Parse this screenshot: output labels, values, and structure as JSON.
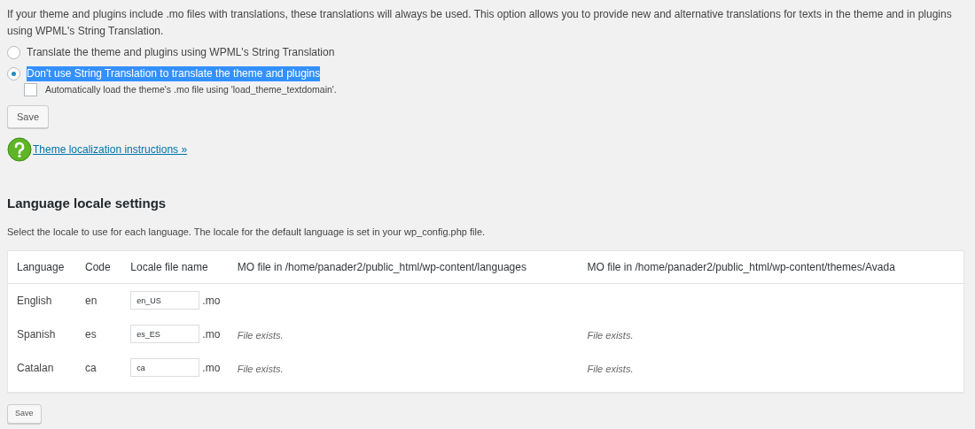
{
  "intro": "If your theme and plugins include .mo files with translations, these translations will always be used. This option allows you to provide new and alternative translations for texts in the theme and in plugins using WPML's String Translation.",
  "options": [
    {
      "label": "Translate the theme and plugins using WPML's String Translation",
      "selected": false,
      "text_highlighted": false
    },
    {
      "label": "Don't use String Translation to translate the theme and plugins",
      "selected": true,
      "text_highlighted": true
    }
  ],
  "autoload": {
    "label": "Automatically load the theme's .mo file using 'load_theme_textdomain'.",
    "checked": false
  },
  "save_button": "Save",
  "help_link": "Theme localization instructions »",
  "locale_section": {
    "heading": "Language locale settings",
    "description": "Select the locale to use for each language. The locale for the default language is set in your wp_config.php file.",
    "columns": [
      "Language",
      "Code",
      "Locale file name",
      "MO file in /home/panader2/public_html/wp-content/languages",
      "MO file in /home/panader2/public_html/wp-content/themes/Avada"
    ],
    "rows": [
      {
        "language": "English",
        "code": "en",
        "locale": "en_US",
        "suffix": ".mo"
      },
      {
        "language": "Spanish",
        "code": "es",
        "locale": "es_ES",
        "suffix": ".mo",
        "mo_languages": "File exists.",
        "mo_theme": "File exists."
      },
      {
        "language": "Catalan",
        "code": "ca",
        "locale": "ca",
        "suffix": ".mo",
        "mo_languages": "File exists.",
        "mo_theme": "File exists."
      }
    ],
    "save_button": "Save"
  }
}
